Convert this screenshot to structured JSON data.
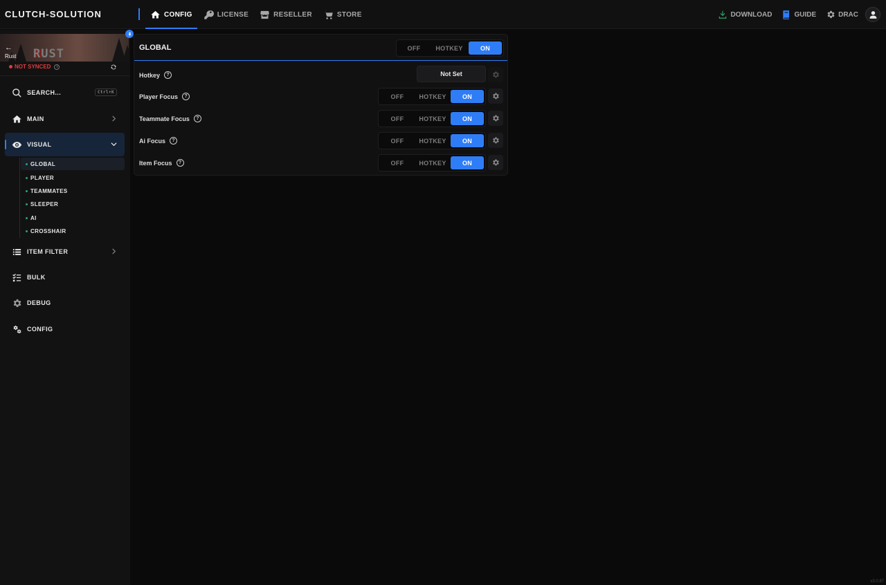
{
  "app": {
    "brand": "CLUTCH-SOLUTION",
    "version": "v3.0.87"
  },
  "colors": {
    "accent": "#2f7df6",
    "error": "#e03b3b",
    "success": "#2fa36b",
    "download": "#2fa36b",
    "guide": "#2f7df6"
  },
  "nav": {
    "items": [
      {
        "label": "CONFIG",
        "icon": "home-icon",
        "active": true
      },
      {
        "label": "LICENSE",
        "icon": "key-icon",
        "active": false
      },
      {
        "label": "RESELLER",
        "icon": "store-icon",
        "active": false
      },
      {
        "label": "STORE",
        "icon": "cart-icon",
        "active": false
      }
    ],
    "right": {
      "download": "DOWNLOAD",
      "guide": "GUIDE",
      "user": "DRAC"
    }
  },
  "sidebar": {
    "game": "Rust",
    "back": "←",
    "sync_status": "NOT SYNCED",
    "search": {
      "label": "SEARCH...",
      "shortcut": "Ctrl+K"
    },
    "items": [
      {
        "label": "MAIN",
        "icon": "home-icon"
      },
      {
        "label": "VISUAL",
        "icon": "eye-icon"
      },
      {
        "label": "ITEM FILTER",
        "icon": "list-icon"
      },
      {
        "label": "BULK",
        "icon": "checklist-icon"
      },
      {
        "label": "DEBUG",
        "icon": "gear-icon"
      },
      {
        "label": "CONFIG",
        "icon": "gears-icon"
      }
    ],
    "visual_sub": [
      "GLOBAL",
      "PLAYER",
      "TEAMMATES",
      "SLEEPER",
      "AI",
      "CROSSHAIR"
    ]
  },
  "panel": {
    "title": "GLOBAL",
    "toggle": {
      "off": "OFF",
      "hotkey": "HOTKEY",
      "on": "ON",
      "selected": "ON"
    },
    "rows": [
      {
        "label": "Hotkey",
        "type": "hotkey",
        "value": "Not Set"
      },
      {
        "label": "Player Focus",
        "type": "toggle",
        "selected": "ON"
      },
      {
        "label": "Teammate Focus",
        "type": "toggle",
        "selected": "ON"
      },
      {
        "label": "Ai Focus",
        "type": "toggle",
        "selected": "ON"
      },
      {
        "label": "Item Focus",
        "type": "toggle",
        "selected": "ON"
      }
    ]
  }
}
